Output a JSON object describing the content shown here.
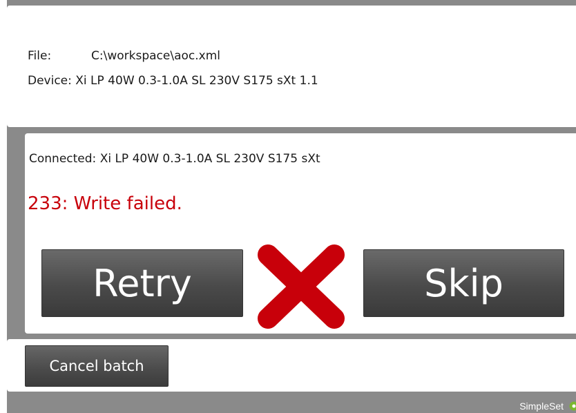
{
  "info": {
    "file_label": "File:",
    "file_value": "C:\\workspace\\aoc.xml",
    "device_label": "Device:",
    "device_value": "Xi LP 40W 0.3-1.0A SL 230V S175 sXt 1.1"
  },
  "status": {
    "connected_label": "Connected:",
    "connected_value": "Xi LP 40W 0.3-1.0A SL 230V S175 sXt",
    "error_message": "233: Write failed.",
    "error_color": "#c8000a",
    "status_icon": "red-x-icon"
  },
  "actions": {
    "retry_label": "Retry",
    "skip_label": "Skip",
    "cancel_label": "Cancel batch"
  },
  "footer": {
    "brand": "SimpleSet",
    "brand_icon": "green-circle-icon",
    "brand_icon_color": "#7ab82e"
  }
}
